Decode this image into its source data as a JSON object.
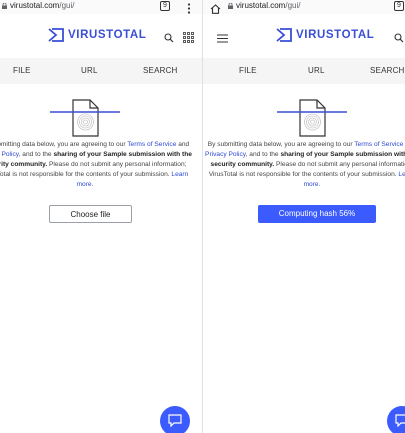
{
  "browser": {
    "url_domain": "virustotal.com",
    "url_path": "/gui/",
    "tab_count": "9"
  },
  "brand": {
    "name": "VIRUSTOTAL",
    "accent": "#3a4ed6"
  },
  "tabs": [
    "FILE",
    "URL",
    "SEARCH"
  ],
  "notice": {
    "p1": "By submitting data below, you are agreeing to our ",
    "terms": "Terms of Service",
    "p2": " and ",
    "privacy": "Privacy Policy",
    "p3": ", and to the ",
    "sharing": "sharing of your Sample submission with the security community.",
    "p4": " Please do not submit any personal information; VirusTotal is not responsible for the contents of your submission. ",
    "learn": "Learn more."
  },
  "left": {
    "button_label": "Choose file"
  },
  "right": {
    "button_label": "Computing hash 56%",
    "progress_percent": 56
  },
  "icons": {
    "lock": "lock-icon",
    "menu": "more-vert-icon",
    "home": "home-icon",
    "search": "search-icon",
    "apps": "apps-grid-icon",
    "hamburger": "hamburger-menu-icon",
    "chat": "chat-icon",
    "file": "fingerprint-file-icon"
  }
}
